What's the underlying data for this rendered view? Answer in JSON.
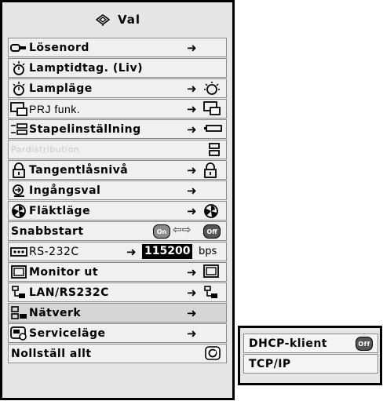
{
  "menu": {
    "title": "Val",
    "items": [
      {
        "label": "Lösenord",
        "icon": "key-icon",
        "arrow": "➜",
        "right_icon": ""
      },
      {
        "label": "Lamptidtag. (Liv)",
        "icon": "lamp-icon",
        "arrow": "",
        "right_icon": ""
      },
      {
        "label": "Lampläge",
        "icon": "lamp-icon",
        "arrow": "➜",
        "right_icon": "eco-lamp-icon"
      },
      {
        "label": "PRJ funk.",
        "icon": "projector-mode-icon",
        "arrow": "➜",
        "right_icon": "projector-mode-icon"
      },
      {
        "label": "Stapelinställning",
        "icon": "stack-icon",
        "arrow": "➜",
        "right_icon": "stack-icon"
      },
      {
        "label": "Pardistribution",
        "icon": "",
        "arrow": "",
        "right_icon": "pair-icon",
        "disabled": true
      },
      {
        "label": "Tangentlåsnivå",
        "icon": "padlock-icon",
        "arrow": "➜",
        "right_icon": "padlock-icon"
      },
      {
        "label": "Ingångsval",
        "icon": "input-select-icon",
        "arrow": "➜",
        "right_icon": ""
      },
      {
        "label": "Fläktläge",
        "icon": "fan-icon",
        "arrow": "➜",
        "right_icon": "fan-icon"
      },
      {
        "label": "Snabbstart",
        "icon": "",
        "arrow": "",
        "right_icon": "",
        "toggle": {
          "on_label": "On",
          "off_label": "Off"
        }
      },
      {
        "label": "RS-232C",
        "icon": "serial-port-icon",
        "arrow": "➜",
        "value": "115200",
        "unit": "bps"
      },
      {
        "label": "Monitor ut",
        "icon": "monitor-icon",
        "arrow": "➜",
        "right_icon": "monitor-icon"
      },
      {
        "label": "LAN/RS232C",
        "icon": "lan-icon",
        "arrow": "➜",
        "right_icon": "lan-icon"
      },
      {
        "label": "Nätverk",
        "icon": "network-icon",
        "arrow": "➜",
        "right_icon": "",
        "highlight": true
      },
      {
        "label": "Serviceläge",
        "icon": "service-icon",
        "arrow": "➜",
        "right_icon": ""
      },
      {
        "label": "Nollställ allt",
        "icon": "",
        "arrow": "",
        "right_icon": "reset-icon"
      }
    ]
  },
  "submenu": {
    "items": [
      {
        "label": "DHCP-klient",
        "badge": "Off"
      },
      {
        "label": "TCP/IP",
        "badge": ""
      }
    ]
  },
  "colors": {
    "panel": "#e6e6e6",
    "row": "#f0f0f0",
    "border": "#000000",
    "disabled": "#c8c8c8"
  }
}
